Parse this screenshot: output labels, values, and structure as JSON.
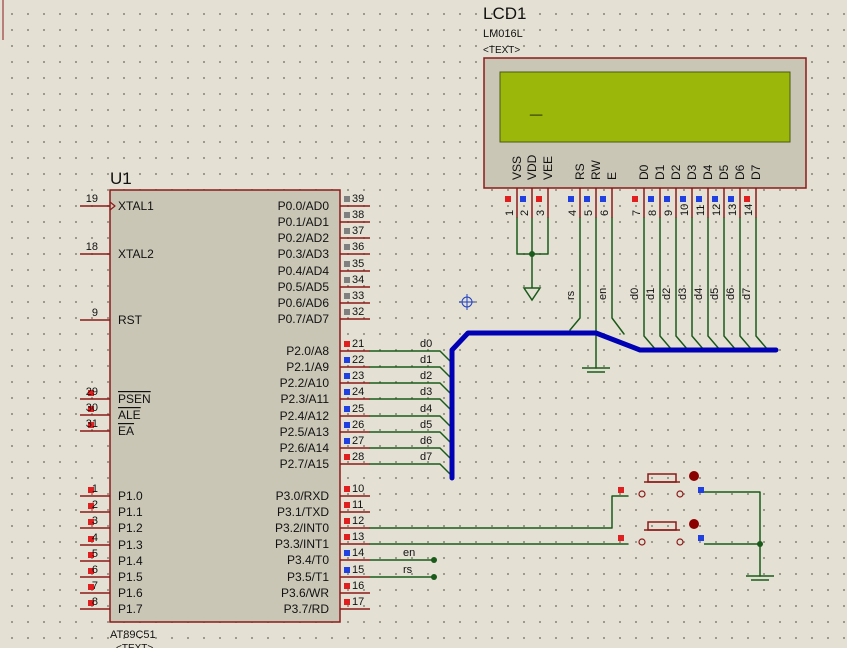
{
  "u1": {
    "ref": "U1",
    "part": "AT89C51",
    "text_placeholder": "<TEXT>",
    "left_pins": [
      {
        "num": "19",
        "name": "XTAL1",
        "marker": "clock"
      },
      {
        "num": "18",
        "name": "XTAL2"
      },
      {
        "num": "9",
        "name": "RST"
      },
      {
        "num": "29",
        "name": "PSEN",
        "overbar": true
      },
      {
        "num": "30",
        "name": "ALE",
        "overbar": true,
        "partial": "ALE"
      },
      {
        "num": "31",
        "name": "EA",
        "overbar": true
      },
      {
        "num": "1",
        "name": "P1.0"
      },
      {
        "num": "2",
        "name": "P1.1"
      },
      {
        "num": "3",
        "name": "P1.2"
      },
      {
        "num": "4",
        "name": "P1.3"
      },
      {
        "num": "5",
        "name": "P1.4"
      },
      {
        "num": "6",
        "name": "P1.5"
      },
      {
        "num": "7",
        "name": "P1.6"
      },
      {
        "num": "8",
        "name": "P1.7"
      }
    ],
    "right_pins": [
      {
        "num": "39",
        "name": "P0.0/AD0",
        "state": "gray"
      },
      {
        "num": "38",
        "name": "P0.1/AD1",
        "state": "gray"
      },
      {
        "num": "37",
        "name": "P0.2/AD2",
        "state": "gray"
      },
      {
        "num": "36",
        "name": "P0.3/AD3",
        "state": "gray"
      },
      {
        "num": "35",
        "name": "P0.4/AD4",
        "state": "gray"
      },
      {
        "num": "34",
        "name": "P0.5/AD5",
        "state": "gray"
      },
      {
        "num": "33",
        "name": "P0.6/AD6",
        "state": "gray"
      },
      {
        "num": "32",
        "name": "P0.7/AD7",
        "state": "gray"
      },
      {
        "num": "21",
        "name": "P2.0/A8",
        "state": "high"
      },
      {
        "num": "22",
        "name": "P2.1/A9",
        "state": "low"
      },
      {
        "num": "23",
        "name": "P2.2/A10",
        "state": "low"
      },
      {
        "num": "24",
        "name": "P2.3/A11",
        "state": "low"
      },
      {
        "num": "25",
        "name": "P2.4/A12",
        "state": "low"
      },
      {
        "num": "26",
        "name": "P2.5/A13",
        "state": "low"
      },
      {
        "num": "27",
        "name": "P2.6/A14",
        "state": "low"
      },
      {
        "num": "28",
        "name": "P2.7/A15",
        "state": "high"
      },
      {
        "num": "10",
        "name": "P3.0/RXD",
        "state": "high"
      },
      {
        "num": "11",
        "name": "P3.1/TXD",
        "state": "high"
      },
      {
        "num": "12",
        "name": "P3.2/INT0",
        "state": "high"
      },
      {
        "num": "13",
        "name": "P3.3/INT1",
        "state": "high"
      },
      {
        "num": "14",
        "name": "P3.4/T0",
        "state": "low"
      },
      {
        "num": "15",
        "name": "P3.5/T1",
        "state": "low"
      },
      {
        "num": "16",
        "name": "P3.6/WR",
        "state": "high"
      },
      {
        "num": "17",
        "name": "P3.7/RD",
        "state": "high"
      }
    ]
  },
  "lcd": {
    "ref": "LCD1",
    "part": "LM016L",
    "text_placeholder": "<TEXT>",
    "display_text": "_",
    "pins": [
      {
        "num": "1",
        "name": "VSS",
        "state": "high"
      },
      {
        "num": "2",
        "name": "VDD",
        "state": "low"
      },
      {
        "num": "3",
        "name": "VEE",
        "state": "high"
      },
      {
        "num": "4",
        "name": "RS",
        "state": "low"
      },
      {
        "num": "5",
        "name": "RW",
        "state": "low"
      },
      {
        "num": "6",
        "name": "E",
        "state": "low"
      },
      {
        "num": "7",
        "name": "D0",
        "state": "high"
      },
      {
        "num": "8",
        "name": "D1",
        "state": "low"
      },
      {
        "num": "9",
        "name": "D2",
        "state": "low"
      },
      {
        "num": "10",
        "name": "D3",
        "state": "low"
      },
      {
        "num": "11",
        "name": "D4",
        "state": "low"
      },
      {
        "num": "12",
        "name": "D5",
        "state": "low"
      },
      {
        "num": "13",
        "name": "D6",
        "state": "low"
      },
      {
        "num": "14",
        "name": "D7",
        "state": "high"
      }
    ]
  },
  "nets": {
    "data": [
      "d0",
      "d1",
      "d2",
      "d3",
      "d4",
      "d5",
      "d6",
      "d7"
    ],
    "lcd_labels": [
      "rs",
      "en",
      "d0",
      "d1",
      "d2",
      "d3",
      "d4",
      "d5",
      "d6",
      "d7"
    ],
    "en": "en",
    "rs": "rs"
  },
  "colors": {
    "background": "#e4e1d4",
    "grid_dot": "#8a8878",
    "component_fill": "#c9c6b6",
    "outline": "#8b1a1a",
    "wire": "#1a5a1a",
    "bus": "#0000b4",
    "lcd_screen": "#9bb80a",
    "pin_high": "#e02020",
    "pin_low": "#2040e0",
    "pin_float": "#808080"
  }
}
